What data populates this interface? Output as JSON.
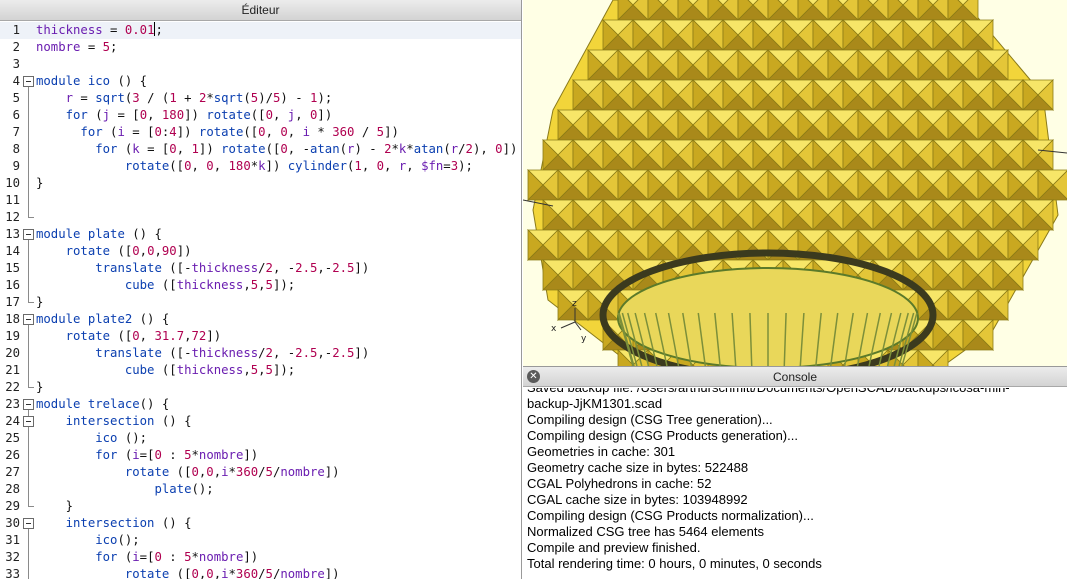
{
  "editor": {
    "title": "Éditeur",
    "lines": [
      {
        "n": "1",
        "fold": "none",
        "current": true,
        "indent": 0,
        "tokens": [
          [
            "var",
            "thickness"
          ],
          [
            "op",
            " = "
          ],
          [
            "num",
            "0.01"
          ],
          [
            "op",
            ";"
          ]
        ]
      },
      {
        "n": "2",
        "fold": "none",
        "indent": 0,
        "tokens": [
          [
            "var",
            "nombre"
          ],
          [
            "op",
            " = "
          ],
          [
            "num",
            "5"
          ],
          [
            "op",
            ";"
          ]
        ]
      },
      {
        "n": "3",
        "fold": "none",
        "indent": 0,
        "tokens": []
      },
      {
        "n": "4",
        "fold": "start",
        "indent": 0,
        "tokens": [
          [
            "kw",
            "module"
          ],
          [
            "op",
            " "
          ],
          [
            "fn",
            "ico"
          ],
          [
            "op",
            " () {"
          ]
        ]
      },
      {
        "n": "5",
        "fold": "line",
        "indent": 4,
        "tokens": [
          [
            "var",
            "r"
          ],
          [
            "op",
            " = "
          ],
          [
            "fn",
            "sqrt"
          ],
          [
            "op",
            "("
          ],
          [
            "num",
            "3"
          ],
          [
            "op",
            " / ("
          ],
          [
            "num",
            "1"
          ],
          [
            "op",
            " + "
          ],
          [
            "num",
            "2"
          ],
          [
            "op",
            "*"
          ],
          [
            "fn",
            "sqrt"
          ],
          [
            "op",
            "("
          ],
          [
            "num",
            "5"
          ],
          [
            "op",
            ")/"
          ],
          [
            "num",
            "5"
          ],
          [
            "op",
            ") - "
          ],
          [
            "num",
            "1"
          ],
          [
            "op",
            ");"
          ]
        ]
      },
      {
        "n": "6",
        "fold": "line",
        "indent": 4,
        "tokens": [
          [
            "kw",
            "for"
          ],
          [
            "op",
            " ("
          ],
          [
            "var",
            "j"
          ],
          [
            "op",
            " = ["
          ],
          [
            "num",
            "0"
          ],
          [
            "op",
            ", "
          ],
          [
            "num",
            "180"
          ],
          [
            "op",
            "]) "
          ],
          [
            "fn",
            "rotate"
          ],
          [
            "op",
            "(["
          ],
          [
            "num",
            "0"
          ],
          [
            "op",
            ", "
          ],
          [
            "var",
            "j"
          ],
          [
            "op",
            ", "
          ],
          [
            "num",
            "0"
          ],
          [
            "op",
            "])"
          ]
        ]
      },
      {
        "n": "7",
        "fold": "line",
        "indent": 6,
        "tokens": [
          [
            "kw",
            "for"
          ],
          [
            "op",
            " ("
          ],
          [
            "var",
            "i"
          ],
          [
            "op",
            " = ["
          ],
          [
            "num",
            "0"
          ],
          [
            "op",
            ":"
          ],
          [
            "num",
            "4"
          ],
          [
            "op",
            "]) "
          ],
          [
            "fn",
            "rotate"
          ],
          [
            "op",
            "(["
          ],
          [
            "num",
            "0"
          ],
          [
            "op",
            ", "
          ],
          [
            "num",
            "0"
          ],
          [
            "op",
            ", "
          ],
          [
            "var",
            "i"
          ],
          [
            "op",
            " * "
          ],
          [
            "num",
            "360"
          ],
          [
            "op",
            " / "
          ],
          [
            "num",
            "5"
          ],
          [
            "op",
            "])"
          ]
        ]
      },
      {
        "n": "8",
        "fold": "line",
        "indent": 8,
        "tokens": [
          [
            "kw",
            "for"
          ],
          [
            "op",
            " ("
          ],
          [
            "var",
            "k"
          ],
          [
            "op",
            " = ["
          ],
          [
            "num",
            "0"
          ],
          [
            "op",
            ", "
          ],
          [
            "num",
            "1"
          ],
          [
            "op",
            "]) "
          ],
          [
            "fn",
            "rotate"
          ],
          [
            "op",
            "(["
          ],
          [
            "num",
            "0"
          ],
          [
            "op",
            ", -"
          ],
          [
            "fn",
            "atan"
          ],
          [
            "op",
            "("
          ],
          [
            "var",
            "r"
          ],
          [
            "op",
            ") - "
          ],
          [
            "num",
            "2"
          ],
          [
            "op",
            "*"
          ],
          [
            "var",
            "k"
          ],
          [
            "op",
            "*"
          ],
          [
            "fn",
            "atan"
          ],
          [
            "op",
            "("
          ],
          [
            "var",
            "r"
          ],
          [
            "op",
            "/"
          ],
          [
            "num",
            "2"
          ],
          [
            "op",
            "), "
          ],
          [
            "num",
            "0"
          ],
          [
            "op",
            "])"
          ]
        ]
      },
      {
        "n": "9",
        "fold": "line",
        "indent": 12,
        "tokens": [
          [
            "fn",
            "rotate"
          ],
          [
            "op",
            "(["
          ],
          [
            "num",
            "0"
          ],
          [
            "op",
            ", "
          ],
          [
            "num",
            "0"
          ],
          [
            "op",
            ", "
          ],
          [
            "num",
            "180"
          ],
          [
            "op",
            "*"
          ],
          [
            "var",
            "k"
          ],
          [
            "op",
            "]) "
          ],
          [
            "fn",
            "cylinder"
          ],
          [
            "op",
            "("
          ],
          [
            "num",
            "1"
          ],
          [
            "op",
            ", "
          ],
          [
            "num",
            "0"
          ],
          [
            "op",
            ", "
          ],
          [
            "var",
            "r"
          ],
          [
            "op",
            ", "
          ],
          [
            "var",
            "$fn"
          ],
          [
            "op",
            "="
          ],
          [
            "num",
            "3"
          ],
          [
            "op",
            ");"
          ]
        ]
      },
      {
        "n": "10",
        "fold": "line",
        "indent": 0,
        "tokens": [
          [
            "op",
            "}"
          ]
        ]
      },
      {
        "n": "11",
        "fold": "line",
        "indent": 0,
        "tokens": []
      },
      {
        "n": "12",
        "fold": "end",
        "indent": 0,
        "tokens": []
      },
      {
        "n": "13",
        "fold": "start",
        "indent": 0,
        "tokens": [
          [
            "kw",
            "module"
          ],
          [
            "op",
            " "
          ],
          [
            "fn",
            "plate"
          ],
          [
            "op",
            " () {"
          ]
        ]
      },
      {
        "n": "14",
        "fold": "line",
        "indent": 4,
        "tokens": [
          [
            "fn",
            "rotate"
          ],
          [
            "op",
            " (["
          ],
          [
            "num",
            "0"
          ],
          [
            "op",
            ","
          ],
          [
            "num",
            "0"
          ],
          [
            "op",
            ","
          ],
          [
            "num",
            "90"
          ],
          [
            "op",
            "])"
          ]
        ]
      },
      {
        "n": "15",
        "fold": "line",
        "indent": 8,
        "tokens": [
          [
            "fn",
            "translate"
          ],
          [
            "op",
            " ([-"
          ],
          [
            "var",
            "thickness"
          ],
          [
            "op",
            "/"
          ],
          [
            "num",
            "2"
          ],
          [
            "op",
            ", -"
          ],
          [
            "num",
            "2.5"
          ],
          [
            "op",
            ",-"
          ],
          [
            "num",
            "2.5"
          ],
          [
            "op",
            "])"
          ]
        ]
      },
      {
        "n": "16",
        "fold": "line",
        "indent": 12,
        "tokens": [
          [
            "fn",
            "cube"
          ],
          [
            "op",
            " (["
          ],
          [
            "var",
            "thickness"
          ],
          [
            "op",
            ","
          ],
          [
            "num",
            "5"
          ],
          [
            "op",
            ","
          ],
          [
            "num",
            "5"
          ],
          [
            "op",
            "]);"
          ]
        ]
      },
      {
        "n": "17",
        "fold": "end",
        "indent": 0,
        "tokens": [
          [
            "op",
            "}"
          ]
        ]
      },
      {
        "n": "18",
        "fold": "start",
        "indent": 0,
        "tokens": [
          [
            "kw",
            "module"
          ],
          [
            "op",
            " "
          ],
          [
            "fn",
            "plate2"
          ],
          [
            "op",
            " () {"
          ]
        ]
      },
      {
        "n": "19",
        "fold": "line",
        "indent": 4,
        "tokens": [
          [
            "fn",
            "rotate"
          ],
          [
            "op",
            " (["
          ],
          [
            "num",
            "0"
          ],
          [
            "op",
            ", "
          ],
          [
            "num",
            "31.7"
          ],
          [
            "op",
            ","
          ],
          [
            "num",
            "72"
          ],
          [
            "op",
            "])"
          ]
        ]
      },
      {
        "n": "20",
        "fold": "line",
        "indent": 8,
        "tokens": [
          [
            "fn",
            "translate"
          ],
          [
            "op",
            " ([-"
          ],
          [
            "var",
            "thickness"
          ],
          [
            "op",
            "/"
          ],
          [
            "num",
            "2"
          ],
          [
            "op",
            ", -"
          ],
          [
            "num",
            "2.5"
          ],
          [
            "op",
            ",-"
          ],
          [
            "num",
            "2.5"
          ],
          [
            "op",
            "])"
          ]
        ]
      },
      {
        "n": "21",
        "fold": "line",
        "indent": 12,
        "tokens": [
          [
            "fn",
            "cube"
          ],
          [
            "op",
            " (["
          ],
          [
            "var",
            "thickness"
          ],
          [
            "op",
            ","
          ],
          [
            "num",
            "5"
          ],
          [
            "op",
            ","
          ],
          [
            "num",
            "5"
          ],
          [
            "op",
            "]);"
          ]
        ]
      },
      {
        "n": "22",
        "fold": "end",
        "indent": 0,
        "tokens": [
          [
            "op",
            "}"
          ]
        ]
      },
      {
        "n": "23",
        "fold": "start",
        "indent": 0,
        "tokens": [
          [
            "kw",
            "module"
          ],
          [
            "op",
            " "
          ],
          [
            "fn",
            "trelace"
          ],
          [
            "op",
            "() {"
          ]
        ]
      },
      {
        "n": "24",
        "fold": "start",
        "indent": 4,
        "tokens": [
          [
            "fn",
            "intersection"
          ],
          [
            "op",
            " () {"
          ]
        ]
      },
      {
        "n": "25",
        "fold": "line",
        "indent": 8,
        "tokens": [
          [
            "fn",
            "ico"
          ],
          [
            "op",
            " ();"
          ]
        ]
      },
      {
        "n": "26",
        "fold": "line",
        "indent": 8,
        "tokens": [
          [
            "kw",
            "for"
          ],
          [
            "op",
            " ("
          ],
          [
            "var",
            "i"
          ],
          [
            "op",
            "=["
          ],
          [
            "num",
            "0"
          ],
          [
            "op",
            " : "
          ],
          [
            "num",
            "5"
          ],
          [
            "op",
            "*"
          ],
          [
            "var",
            "nombre"
          ],
          [
            "op",
            "])"
          ]
        ]
      },
      {
        "n": "27",
        "fold": "line",
        "indent": 12,
        "tokens": [
          [
            "fn",
            "rotate"
          ],
          [
            "op",
            " (["
          ],
          [
            "num",
            "0"
          ],
          [
            "op",
            ","
          ],
          [
            "num",
            "0"
          ],
          [
            "op",
            ","
          ],
          [
            "var",
            "i"
          ],
          [
            "op",
            "*"
          ],
          [
            "num",
            "360"
          ],
          [
            "op",
            "/"
          ],
          [
            "num",
            "5"
          ],
          [
            "op",
            "/"
          ],
          [
            "var",
            "nombre"
          ],
          [
            "op",
            "])"
          ]
        ]
      },
      {
        "n": "28",
        "fold": "line",
        "indent": 16,
        "tokens": [
          [
            "fn",
            "plate"
          ],
          [
            "op",
            "();"
          ]
        ]
      },
      {
        "n": "29",
        "fold": "end",
        "indent": 4,
        "tokens": [
          [
            "op",
            "}"
          ]
        ]
      },
      {
        "n": "30",
        "fold": "start",
        "indent": 4,
        "tokens": [
          [
            "fn",
            "intersection"
          ],
          [
            "op",
            " () {"
          ]
        ]
      },
      {
        "n": "31",
        "fold": "line",
        "indent": 8,
        "tokens": [
          [
            "fn",
            "ico"
          ],
          [
            "op",
            "();"
          ]
        ]
      },
      {
        "n": "32",
        "fold": "line",
        "indent": 8,
        "tokens": [
          [
            "kw",
            "for"
          ],
          [
            "op",
            " ("
          ],
          [
            "var",
            "i"
          ],
          [
            "op",
            "=["
          ],
          [
            "num",
            "0"
          ],
          [
            "op",
            " : "
          ],
          [
            "num",
            "5"
          ],
          [
            "op",
            "*"
          ],
          [
            "var",
            "nombre"
          ],
          [
            "op",
            "])"
          ]
        ]
      },
      {
        "n": "33",
        "fold": "line",
        "indent": 12,
        "tokens": [
          [
            "fn",
            "rotate"
          ],
          [
            "op",
            " (["
          ],
          [
            "num",
            "0"
          ],
          [
            "op",
            ","
          ],
          [
            "num",
            "0"
          ],
          [
            "op",
            ","
          ],
          [
            "var",
            "i"
          ],
          [
            "op",
            "*"
          ],
          [
            "num",
            "360"
          ],
          [
            "op",
            "/"
          ],
          [
            "num",
            "5"
          ],
          [
            "op",
            "/"
          ],
          [
            "var",
            "nombre"
          ],
          [
            "op",
            "])"
          ]
        ]
      }
    ]
  },
  "viewer": {
    "axes": {
      "x": "x",
      "y": "y",
      "z": "z"
    },
    "model_color": "#f2d53a",
    "background_color": "#ffffe5"
  },
  "console": {
    "title": "Console",
    "lines": [
      "Saved backup file: /Users/arthurschmitt/Documents/OpenSCAD/backups/icosa-min-",
      "backup-JjKM1301.scad",
      "Compiling design (CSG Tree generation)...",
      "Compiling design (CSG Products generation)...",
      "Geometries in cache: 301",
      "Geometry cache size in bytes: 522488",
      "CGAL Polyhedrons in cache: 52",
      "CGAL cache size in bytes: 103948992",
      "Compiling design (CSG Products normalization)...",
      "Normalized CSG tree has 5464 elements",
      "Compile and preview finished.",
      "Total rendering time: 0 hours, 0 minutes, 0 seconds"
    ]
  }
}
